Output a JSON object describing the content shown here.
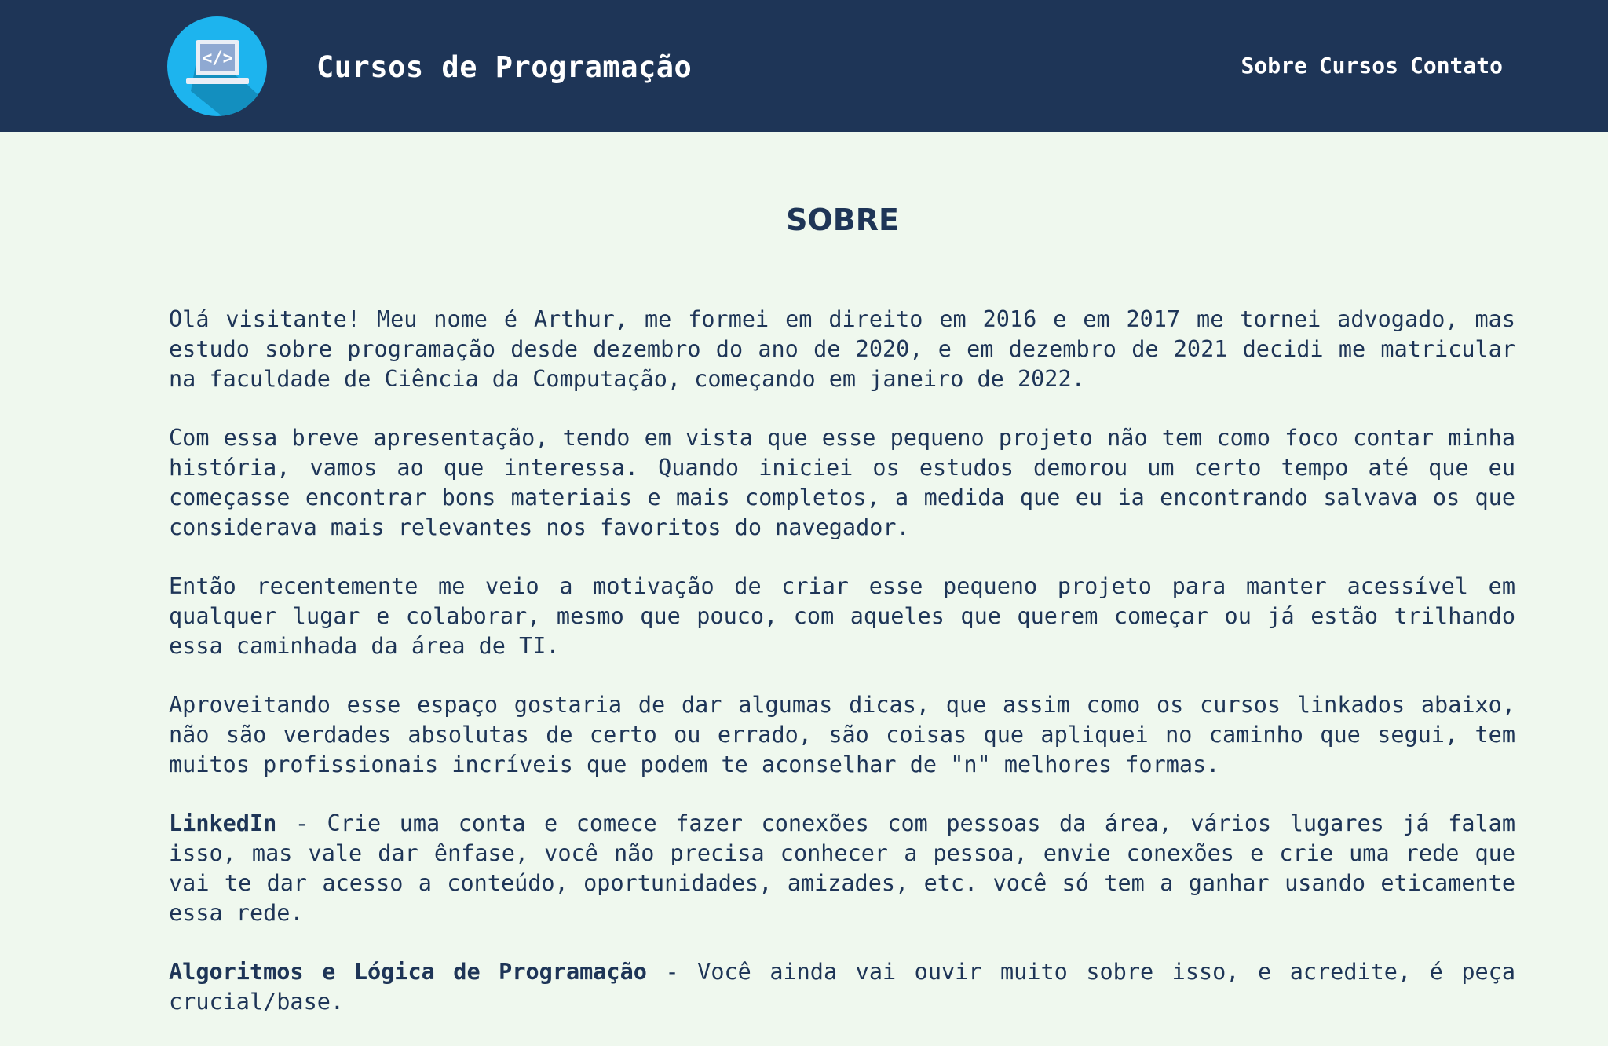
{
  "header": {
    "logo_icon": "code-laptop-icon",
    "site_title": "Cursos de Programação",
    "nav": [
      {
        "label": "Sobre"
      },
      {
        "label": "Cursos"
      },
      {
        "label": "Contato"
      }
    ]
  },
  "main": {
    "heading": "SOBRE",
    "paragraphs": [
      {
        "text": "Olá visitante! Meu nome é Arthur, me formei em direito em 2016 e em 2017 me tornei advogado, mas estudo sobre programação desde dezembro do ano de 2020, e em dezembro de 2021 decidi me matricular na faculdade de Ciência da Computação, começando em janeiro de 2022."
      },
      {
        "text": "Com essa breve apresentação, tendo em vista que esse pequeno projeto não tem como foco contar minha história, vamos ao que interessa. Quando iniciei os estudos demorou um certo tempo até que eu começasse encontrar bons materiais e mais completos, a medida que eu ia encontrando salvava os que considerava mais relevantes nos favoritos do navegador."
      },
      {
        "text": "Então recentemente me veio a motivação de criar esse pequeno projeto para manter acessível em qualquer lugar e colaborar, mesmo que pouco, com aqueles que querem começar ou já estão trilhando essa caminhada da área de TI."
      },
      {
        "text": "Aproveitando esse espaço gostaria de dar algumas dicas, que assim como os cursos linkados abaixo, não são verdades absolutas de certo ou errado, são coisas que apliquei no caminho que segui, tem muitos profissionais incríveis que podem te aconselhar de \"n\" melhores formas."
      }
    ],
    "tips": [
      {
        "title": "LinkedIn",
        "text": " - Crie uma conta e comece fazer conexões com pessoas da área, vários lugares já falam isso, mas vale dar ênfase, você não precisa conhecer a pessoa, envie conexões e crie uma rede que vai te dar acesso a conteúdo, oportunidades, amizades, etc. você só tem a ganhar usando eticamente essa rede."
      },
      {
        "title": "Algoritmos e Lógica de Programação",
        "text": " - Você ainda vai ouvir muito sobre isso, e acredite, é peça crucial/base."
      }
    ]
  }
}
